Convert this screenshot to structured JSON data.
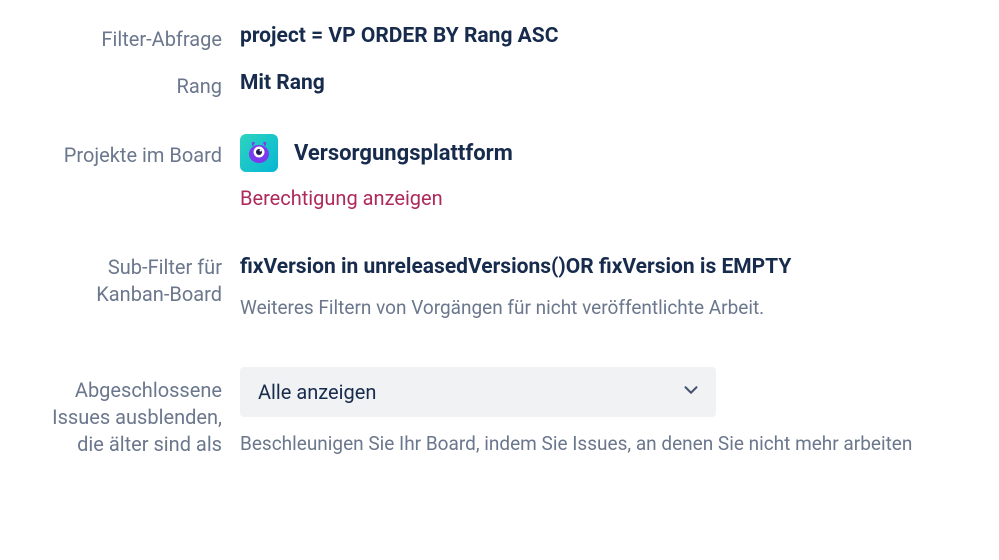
{
  "labels": {
    "filter_query": "Filter-Abfrage",
    "rank": "Rang",
    "projects_in_board": "Projekte im Board",
    "sub_filter_l1": "Sub-Filter für",
    "sub_filter_l2": "Kanban-Board",
    "hide_completed_l1": "Abgeschlossene",
    "hide_completed_l2": "Issues ausblenden,",
    "hide_completed_l3": "die älter sind als"
  },
  "values": {
    "filter_query": "project = VP ORDER BY Rang ASC",
    "rank": "Mit Rang",
    "project_name": "Versorgungsplattform",
    "permission_link": "Berechtigung anzeigen",
    "sub_filter": "fixVersion in unreleasedVersions()OR fixVersion is EMPTY",
    "sub_filter_help": "Weiteres Filtern von Vorgängen für nicht veröffentlichte Arbeit.",
    "hide_completed_selected": "Alle anzeigen",
    "hide_completed_help": "Beschleunigen Sie Ihr Board, indem Sie Issues, an denen Sie nicht mehr arbeiten"
  }
}
